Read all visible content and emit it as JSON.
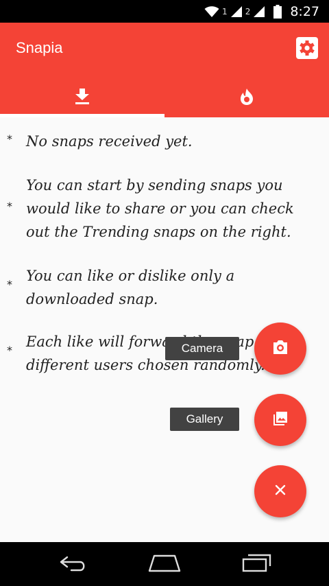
{
  "status_bar": {
    "sim1": "1",
    "sim2": "2",
    "time": "8:27"
  },
  "toolbar": {
    "title": "Snapia",
    "accent_color": "#f44336"
  },
  "tabs": [
    {
      "icon": "download-icon",
      "selected": true
    },
    {
      "icon": "trending-flame-icon",
      "selected": false
    }
  ],
  "tips": [
    {
      "bullet": "*",
      "text": "No snaps received yet."
    },
    {
      "bullet": "*",
      "text": "You can start by sending snaps you would like to share or you can check out the Trending snaps on the right."
    },
    {
      "bullet": "*",
      "text": "You can like or dislike only a downloaded snap."
    },
    {
      "bullet": "*",
      "text": "Each like will forward the snap to 3 different users chosen randomly."
    }
  ],
  "fab_menu": {
    "camera_label": "Camera",
    "gallery_label": "Gallery",
    "camera_icon": "camera-icon",
    "gallery_icon": "gallery-icon",
    "close_icon": "close-icon"
  },
  "nav_bar": {
    "back_icon": "back-icon",
    "home_icon": "home-icon",
    "recent_icon": "recent-apps-icon"
  }
}
